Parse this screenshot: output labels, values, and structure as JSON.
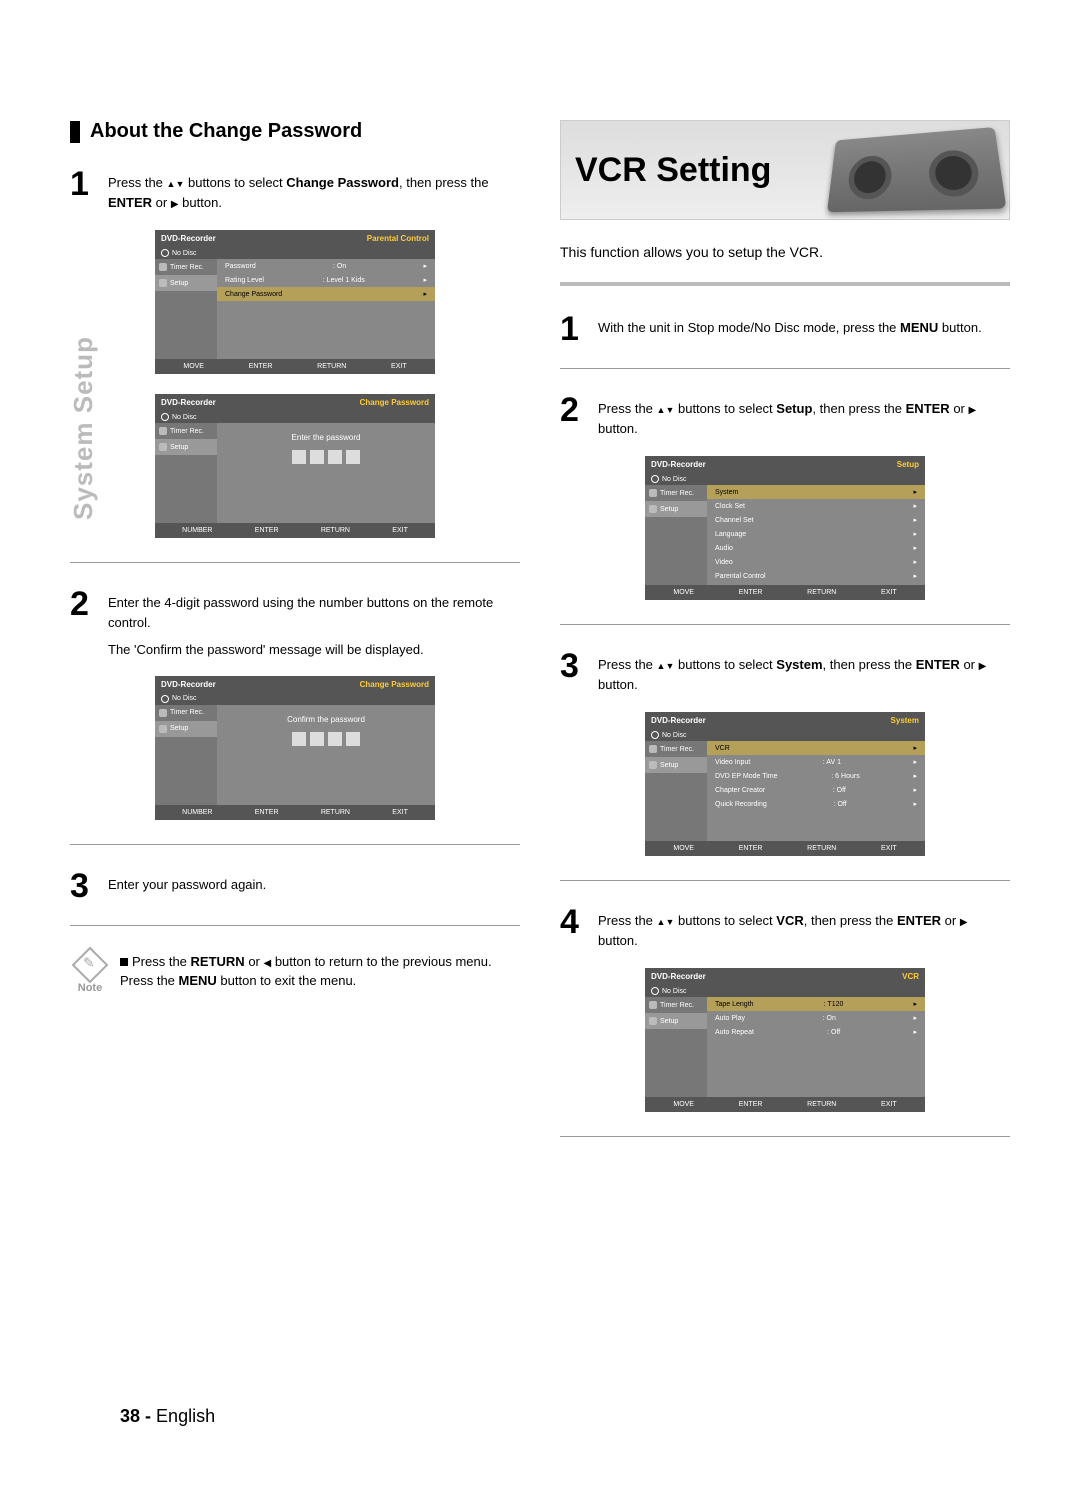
{
  "side_tab": "System Setup",
  "left": {
    "heading": "About the Change Password",
    "step1": {
      "num": "1",
      "text_a": "Press the ",
      "text_b": " buttons to select ",
      "bold1": "Change Password",
      "text_c": ", then press the ",
      "bold2": "ENTER",
      "text_d": " or ",
      "text_e": " button."
    },
    "osd1": {
      "title": "DVD-Recorder",
      "rlabel": "Parental Control",
      "nodisc": "No Disc",
      "side_timer": "Timer Rec.",
      "side_setup": "Setup",
      "rows": [
        {
          "k": "Password",
          "v": ": On"
        },
        {
          "k": "Rating Level",
          "v": ": Level 1 Kids"
        }
      ],
      "hl": "Change Password",
      "foot": [
        "MOVE",
        "ENTER",
        "RETURN",
        "EXIT"
      ]
    },
    "osd2": {
      "title": "DVD-Recorder",
      "rlabel": "Change Password",
      "nodisc": "No Disc",
      "prompt": "Enter the password",
      "foot": [
        "NUMBER",
        "ENTER",
        "RETURN",
        "EXIT"
      ]
    },
    "step2": {
      "num": "2",
      "text": "Enter the 4-digit password using the number buttons on the remote control.",
      "sub": "The 'Confirm the password' message will be displayed."
    },
    "osd3": {
      "title": "DVD-Recorder",
      "rlabel": "Change Password",
      "nodisc": "No Disc",
      "prompt": "Confirm the password",
      "foot": [
        "NUMBER",
        "ENTER",
        "RETURN",
        "EXIT"
      ]
    },
    "step3": {
      "num": "3",
      "text": "Enter your password again."
    },
    "note": {
      "label": "Note",
      "line1a": "Press the ",
      "bold1": "RETURN",
      "line1b": " or ",
      "line1c": " button to return to the previous menu.",
      "line2a": "Press the ",
      "bold2": "MENU",
      "line2b": " button to exit the menu."
    }
  },
  "right": {
    "title": "VCR Setting",
    "intro": "This function allows you to setup the VCR.",
    "step1": {
      "num": "1",
      "text_a": "With the unit in Stop mode/No Disc mode, press the ",
      "bold": "MENU",
      "text_b": " button."
    },
    "step2": {
      "num": "2",
      "text_a": "Press the ",
      "text_b": " buttons to select ",
      "bold1": "Setup",
      "text_c": ", then press the ",
      "bold2": "ENTER",
      "text_d": " or ",
      "text_e": " button."
    },
    "osd1": {
      "title": "DVD-Recorder",
      "rlabel": "Setup",
      "nodisc": "No Disc",
      "side_timer": "Timer Rec.",
      "side_setup": "Setup",
      "hl": "System",
      "rows": [
        "Clock Set",
        "Channel Set",
        "Language",
        "Audio",
        "Video",
        "Parental Control"
      ],
      "foot": [
        "MOVE",
        "ENTER",
        "RETURN",
        "EXIT"
      ]
    },
    "step3": {
      "num": "3",
      "text_a": "Press the ",
      "text_b": " buttons to select ",
      "bold1": "System",
      "text_c": ", then press the ",
      "bold2": "ENTER",
      "text_d": " or ",
      "text_e": " button."
    },
    "osd2": {
      "title": "DVD-Recorder",
      "rlabel": "System",
      "nodisc": "No Disc",
      "hl": "VCR",
      "rows": [
        {
          "k": "Video Input",
          "v": ": AV 1"
        },
        {
          "k": "DVD EP Mode Time",
          "v": ": 6 Hours"
        },
        {
          "k": "Chapter Creator",
          "v": ": Off"
        },
        {
          "k": "Quick Recording",
          "v": ": Off"
        }
      ],
      "foot": [
        "MOVE",
        "ENTER",
        "RETURN",
        "EXIT"
      ]
    },
    "step4": {
      "num": "4",
      "text_a": "Press the ",
      "text_b": " buttons to select ",
      "bold1": "VCR",
      "text_c": ", then press the ",
      "bold2": "ENTER",
      "text_d": " or ",
      "text_e": " button."
    },
    "osd3": {
      "title": "DVD-Recorder",
      "rlabel": "VCR",
      "nodisc": "No Disc",
      "hl": {
        "k": "Tape Length",
        "v": ": T120"
      },
      "rows": [
        {
          "k": "Auto Play",
          "v": ": On"
        },
        {
          "k": "Auto Repeat",
          "v": ": Off"
        }
      ],
      "foot": [
        "MOVE",
        "ENTER",
        "RETURN",
        "EXIT"
      ]
    }
  },
  "footer": {
    "page": "38 -",
    "lang": "English"
  }
}
